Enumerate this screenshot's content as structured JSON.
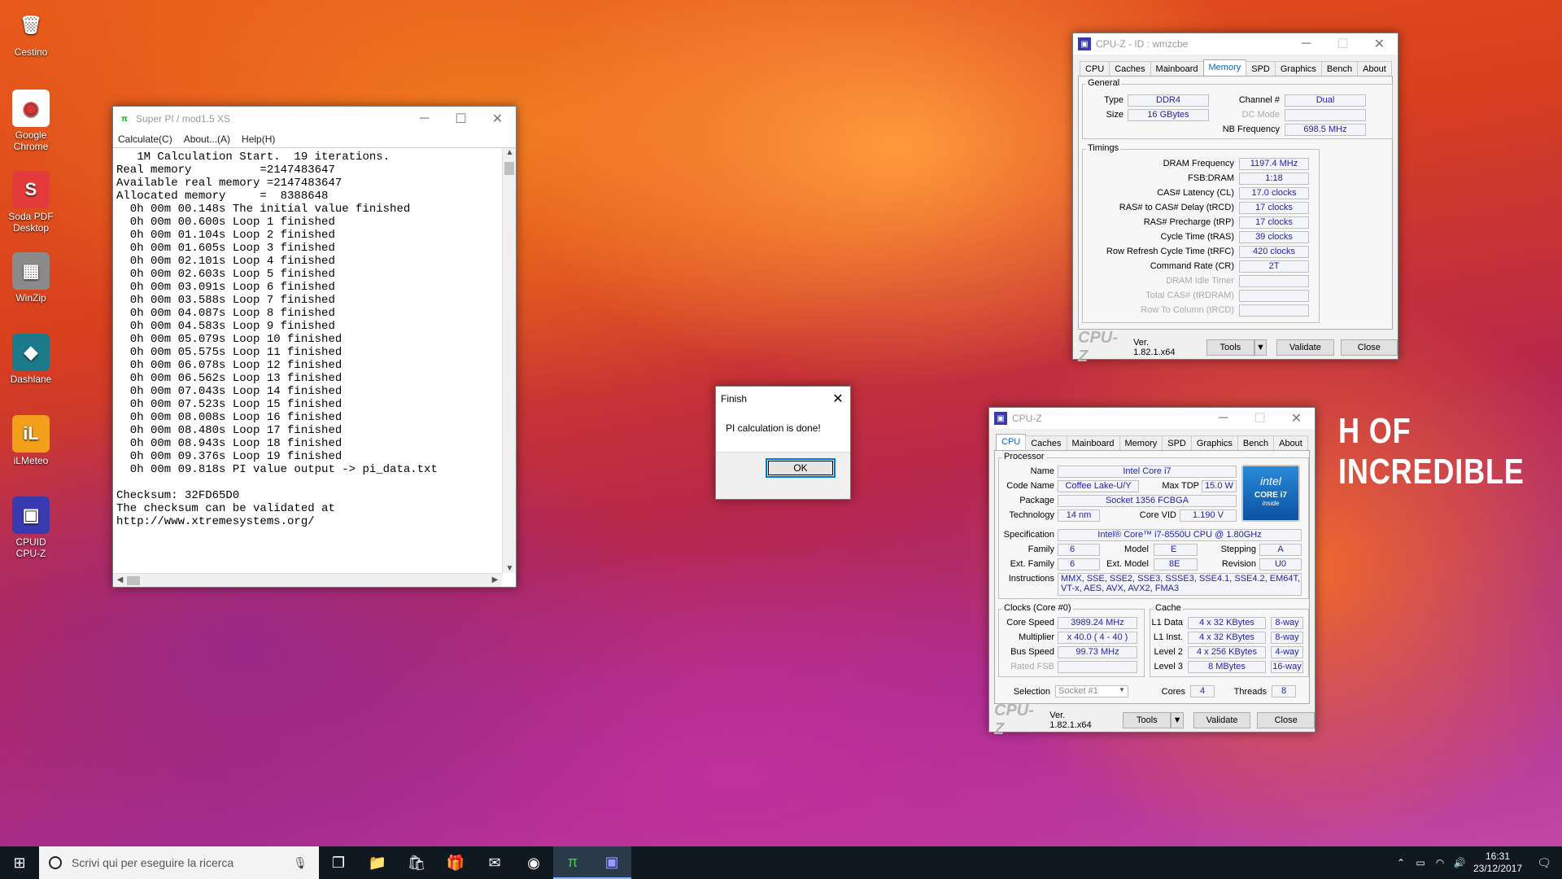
{
  "desktop": {
    "icons": [
      {
        "label": "Cestino",
        "glyph": "🗑",
        "bg": "transparent"
      },
      {
        "label": "Google Chrome",
        "glyph": "◉",
        "bg": "#ffffff"
      },
      {
        "label": "Soda PDF Desktop",
        "glyph": "S",
        "bg": "#e33b3b"
      },
      {
        "label": "WinZip",
        "glyph": "▦",
        "bg": "#8a8a8a"
      },
      {
        "label": "Dashlane",
        "glyph": "◆",
        "bg": "#1a7a8a"
      },
      {
        "label": "iLMeteo",
        "glyph": "iL",
        "bg": "#f2a01a"
      },
      {
        "label": "CPUID CPU-Z",
        "glyph": "▣",
        "bg": "#3a3ab0"
      }
    ],
    "wallpaper_text": "H OF INCREDIBLE"
  },
  "superpi": {
    "title": "Super PI / mod1.5 XS",
    "menu": [
      "Calculate(C)",
      "About...(A)",
      "Help(H)"
    ],
    "lines": [
      "   1M Calculation Start.  19 iterations.",
      "Real memory          =2147483647",
      "Available real memory =2147483647",
      "Allocated memory     =  8388648",
      "  0h 00m 00.148s The initial value finished",
      "  0h 00m 00.600s Loop 1 finished",
      "  0h 00m 01.104s Loop 2 finished",
      "  0h 00m 01.605s Loop 3 finished",
      "  0h 00m 02.101s Loop 4 finished",
      "  0h 00m 02.603s Loop 5 finished",
      "  0h 00m 03.091s Loop 6 finished",
      "  0h 00m 03.588s Loop 7 finished",
      "  0h 00m 04.087s Loop 8 finished",
      "  0h 00m 04.583s Loop 9 finished",
      "  0h 00m 05.079s Loop 10 finished",
      "  0h 00m 05.575s Loop 11 finished",
      "  0h 00m 06.078s Loop 12 finished",
      "  0h 00m 06.562s Loop 13 finished",
      "  0h 00m 07.043s Loop 14 finished",
      "  0h 00m 07.523s Loop 15 finished",
      "  0h 00m 08.008s Loop 16 finished",
      "  0h 00m 08.480s Loop 17 finished",
      "  0h 00m 08.943s Loop 18 finished",
      "  0h 00m 09.376s Loop 19 finished",
      "  0h 00m 09.818s PI value output -> pi_data.txt",
      "",
      "Checksum: 32FD65D0",
      "The checksum can be validated at",
      "http://www.xtremesystems.org/"
    ]
  },
  "finish": {
    "title": "Finish",
    "message": "PI calculation is done!",
    "ok": "OK"
  },
  "cpuz_mem": {
    "title": "CPU-Z  - ID : wmzcbe",
    "tabs": [
      "CPU",
      "Caches",
      "Mainboard",
      "Memory",
      "SPD",
      "Graphics",
      "Bench",
      "About"
    ],
    "active_tab": "Memory",
    "general_label": "General",
    "type_label": "Type",
    "type": "DDR4",
    "size_label": "Size",
    "size": "16 GBytes",
    "channel_label": "Channel #",
    "channel": "Dual",
    "dcmode_label": "DC Mode",
    "nbfreq_label": "NB Frequency",
    "nbfreq": "698.5 MHz",
    "timings_label": "Timings",
    "timings": [
      {
        "label": "DRAM Frequency",
        "value": "1197.4 MHz",
        "dim": false
      },
      {
        "label": "FSB:DRAM",
        "value": "1:18",
        "dim": false
      },
      {
        "label": "CAS# Latency (CL)",
        "value": "17.0 clocks",
        "dim": false
      },
      {
        "label": "RAS# to CAS# Delay (tRCD)",
        "value": "17 clocks",
        "dim": false
      },
      {
        "label": "RAS# Precharge (tRP)",
        "value": "17 clocks",
        "dim": false
      },
      {
        "label": "Cycle Time (tRAS)",
        "value": "39 clocks",
        "dim": false
      },
      {
        "label": "Row Refresh Cycle Time (tRFC)",
        "value": "420 clocks",
        "dim": false
      },
      {
        "label": "Command Rate (CR)",
        "value": "2T",
        "dim": false
      },
      {
        "label": "DRAM Idle Timer",
        "value": "",
        "dim": true
      },
      {
        "label": "Total CAS# (tRDRAM)",
        "value": "",
        "dim": true
      },
      {
        "label": "Row To Column (tRCD)",
        "value": "",
        "dim": true
      }
    ],
    "logo": "CPU-Z",
    "version": "Ver. 1.82.1.x64",
    "tools": "Tools",
    "validate": "Validate",
    "close": "Close"
  },
  "cpuz_cpu": {
    "title": "CPU-Z",
    "tabs": [
      "CPU",
      "Caches",
      "Mainboard",
      "Memory",
      "SPD",
      "Graphics",
      "Bench",
      "About"
    ],
    "active_tab": "CPU",
    "processor_label": "Processor",
    "name_label": "Name",
    "name": "Intel Core i7",
    "codename_label": "Code Name",
    "codename": "Coffee Lake-U/Y",
    "maxtdp_label": "Max TDP",
    "maxtdp": "15.0 W",
    "package_label": "Package",
    "package": "Socket 1356 FCBGA",
    "technology_label": "Technology",
    "technology": "14 nm",
    "corevid_label": "Core VID",
    "corevid": "1.190 V",
    "spec_label": "Specification",
    "spec": "Intel® Core™ i7-8550U CPU @ 1.80GHz",
    "family_label": "Family",
    "family": "6",
    "model_label": "Model",
    "model": "E",
    "stepping_label": "Stepping",
    "stepping": "A",
    "extfamily_label": "Ext. Family",
    "extfamily": "6",
    "extmodel_label": "Ext. Model",
    "extmodel": "8E",
    "revision_label": "Revision",
    "revision": "U0",
    "instructions_label": "Instructions",
    "instructions": "MMX, SSE, SSE2, SSE3, SSSE3, SSE4.1, SSE4.2, EM64T, VT-x, AES, AVX, AVX2, FMA3",
    "intel_badge": {
      "brand": "intel",
      "line": "CORE i7",
      "sub": "inside"
    },
    "clocks_label": "Clocks (Core #0)",
    "corespeed_label": "Core Speed",
    "corespeed": "3989.24 MHz",
    "multiplier_label": "Multiplier",
    "multiplier": "x 40.0 ( 4 - 40 )",
    "busspeed_label": "Bus Speed",
    "busspeed": "99.73 MHz",
    "ratedfsb_label": "Rated FSB",
    "cache_label": "Cache",
    "cache": [
      {
        "label": "L1 Data",
        "size": "4 x 32 KBytes",
        "way": "8-way"
      },
      {
        "label": "L1 Inst.",
        "size": "4 x 32 KBytes",
        "way": "8-way"
      },
      {
        "label": "Level 2",
        "size": "4 x 256 KBytes",
        "way": "4-way"
      },
      {
        "label": "Level 3",
        "size": "8 MBytes",
        "way": "16-way"
      }
    ],
    "selection_label": "Selection",
    "selection": "Socket #1",
    "cores_label": "Cores",
    "cores": "4",
    "threads_label": "Threads",
    "threads": "8",
    "logo": "CPU-Z",
    "version": "Ver. 1.82.1.x64",
    "tools": "Tools",
    "validate": "Validate",
    "close": "Close"
  },
  "taskbar": {
    "search_placeholder": "Scrivi qui per eseguire la ricerca",
    "time": "16:31",
    "date": "23/12/2017"
  }
}
